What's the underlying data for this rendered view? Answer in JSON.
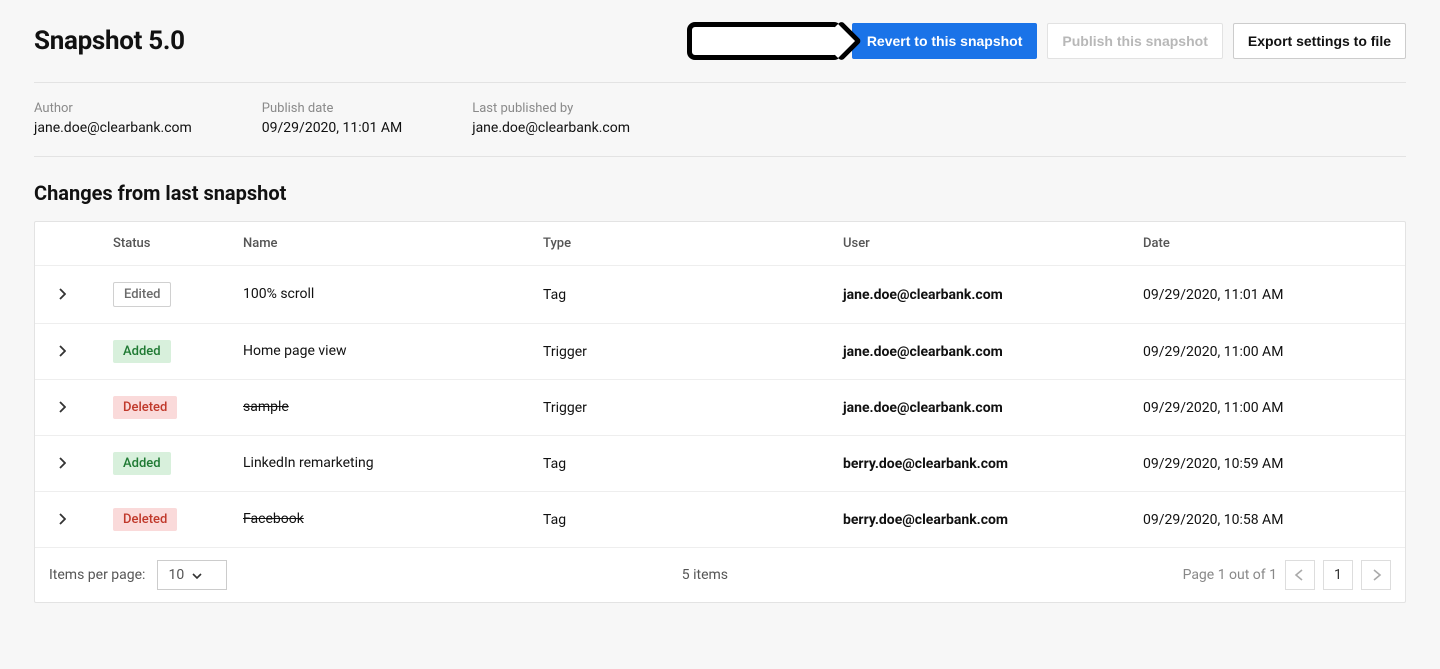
{
  "title": "Snapshot 5.0",
  "actions": {
    "revert": "Revert to this snapshot",
    "publish": "Publish this snapshot",
    "export": "Export settings to file"
  },
  "meta": {
    "author_label": "Author",
    "author_value": "jane.doe@clearbank.com",
    "publish_date_label": "Publish date",
    "publish_date_value": "09/29/2020, 11:01 AM",
    "last_published_by_label": "Last published by",
    "last_published_by_value": "jane.doe@clearbank.com"
  },
  "section_title": "Changes from last snapshot",
  "columns": {
    "status": "Status",
    "name": "Name",
    "type": "Type",
    "user": "User",
    "date": "Date"
  },
  "rows": [
    {
      "status": "Edited",
      "status_kind": "edited",
      "name": "100% scroll",
      "strike": false,
      "type": "Tag",
      "user": "jane.doe@clearbank.com",
      "date": "09/29/2020, 11:01 AM"
    },
    {
      "status": "Added",
      "status_kind": "added",
      "name": "Home page view",
      "strike": false,
      "type": "Trigger",
      "user": "jane.doe@clearbank.com",
      "date": "09/29/2020, 11:00 AM"
    },
    {
      "status": "Deleted",
      "status_kind": "deleted",
      "name": "sample",
      "strike": true,
      "type": "Trigger",
      "user": "jane.doe@clearbank.com",
      "date": "09/29/2020, 11:00 AM"
    },
    {
      "status": "Added",
      "status_kind": "added",
      "name": "LinkedIn remarketing",
      "strike": false,
      "type": "Tag",
      "user": "berry.doe@clearbank.com",
      "date": "09/29/2020, 10:59 AM"
    },
    {
      "status": "Deleted",
      "status_kind": "deleted",
      "name": "Facebook",
      "strike": true,
      "type": "Tag",
      "user": "berry.doe@clearbank.com",
      "date": "09/29/2020, 10:58 AM"
    }
  ],
  "footer": {
    "items_per_page_label": "Items per page:",
    "items_per_page_value": "10",
    "count_text": "5 items",
    "page_text": "Page 1 out of 1",
    "page_value": "1"
  }
}
